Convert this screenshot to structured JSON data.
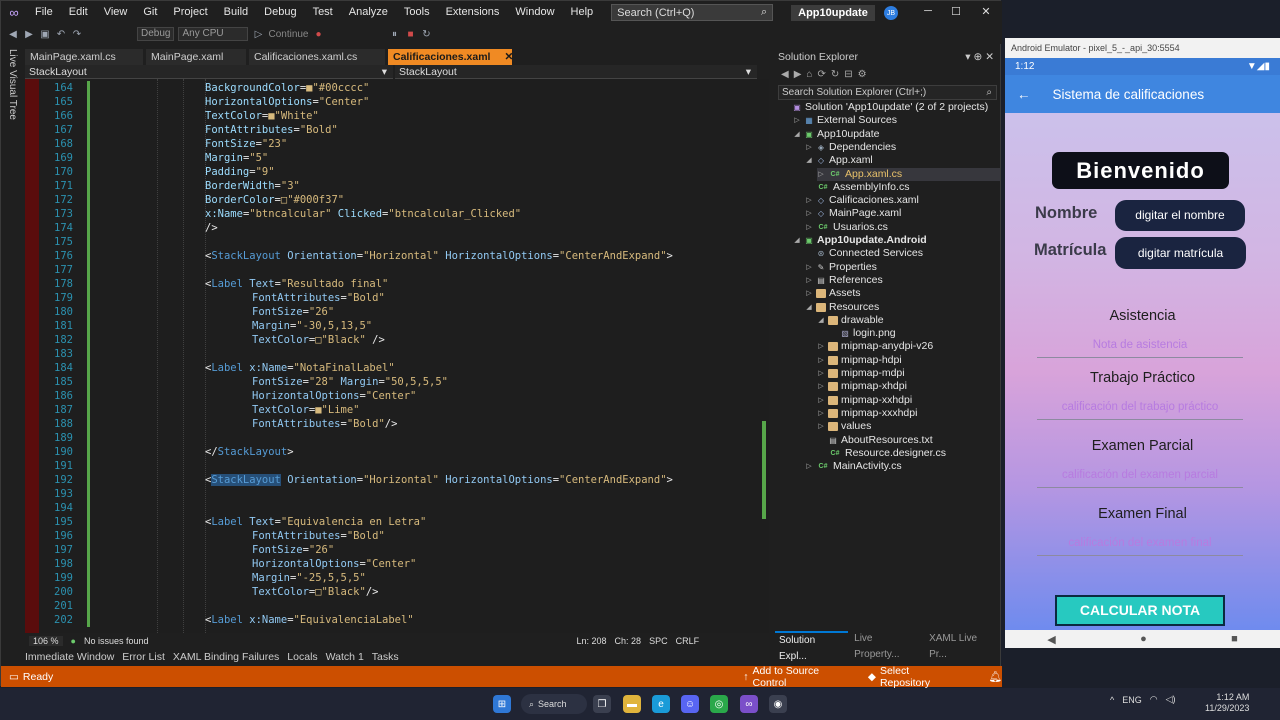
{
  "menubar": {
    "items": [
      "File",
      "Edit",
      "View",
      "Git",
      "Project",
      "Build",
      "Debug",
      "Test",
      "Analyze",
      "Tools",
      "Extensions",
      "Window",
      "Help"
    ],
    "search": "Search (Ctrl+Q)",
    "project": "App10update",
    "avatar": "JB"
  },
  "toolbar": {
    "config": "Debug",
    "platform": "Any CPU",
    "continue": "Continue"
  },
  "live_visual_tree": "Live Visual Tree",
  "tabs": [
    {
      "label": "MainPage.xaml.cs"
    },
    {
      "label": "MainPage.xaml"
    },
    {
      "label": "Calificaciones.xaml.cs"
    },
    {
      "label": "Calificaciones.xaml",
      "active": true
    }
  ],
  "nav": {
    "left": "StackLayout",
    "right": "StackLayout"
  },
  "code_lines": [
    {
      "n": "164",
      "parts": [
        [
          "attr",
          "BackgroundColor"
        ],
        [
          "eq",
          "="
        ],
        [
          "val",
          "■\"#00cccc\""
        ]
      ],
      "indent": 3
    },
    {
      "n": "165",
      "parts": [
        [
          "attr",
          "HorizontalOptions"
        ],
        [
          "eq",
          "="
        ],
        [
          "val",
          "\"Center\""
        ]
      ],
      "indent": 3
    },
    {
      "n": "166",
      "parts": [
        [
          "attr",
          "TextColor"
        ],
        [
          "eq",
          "="
        ],
        [
          "val",
          "■\"White\""
        ]
      ],
      "indent": 3
    },
    {
      "n": "167",
      "parts": [
        [
          "attr",
          "FontAttributes"
        ],
        [
          "eq",
          "="
        ],
        [
          "val",
          "\"Bold\""
        ]
      ],
      "indent": 3
    },
    {
      "n": "168",
      "parts": [
        [
          "attr",
          "FontSize"
        ],
        [
          "eq",
          "="
        ],
        [
          "val",
          "\"23\""
        ]
      ],
      "indent": 3
    },
    {
      "n": "169",
      "parts": [
        [
          "attr",
          "Margin"
        ],
        [
          "eq",
          "="
        ],
        [
          "val",
          "\"5\""
        ]
      ],
      "indent": 3
    },
    {
      "n": "170",
      "parts": [
        [
          "attr",
          "Padding"
        ],
        [
          "eq",
          "="
        ],
        [
          "val",
          "\"9\""
        ]
      ],
      "indent": 3
    },
    {
      "n": "171",
      "parts": [
        [
          "attr",
          "BorderWidth"
        ],
        [
          "eq",
          "="
        ],
        [
          "val",
          "\"3\""
        ]
      ],
      "indent": 3
    },
    {
      "n": "172",
      "parts": [
        [
          "attr",
          "BorderColor"
        ],
        [
          "eq",
          "="
        ],
        [
          "val",
          "□\"#000f37\""
        ]
      ],
      "indent": 3
    },
    {
      "n": "173",
      "parts": [
        [
          "attr",
          "x:Name"
        ],
        [
          "eq",
          "="
        ],
        [
          "val",
          "\"btncalcular\" "
        ],
        [
          "attr",
          "Clicked"
        ],
        [
          "eq",
          "="
        ],
        [
          "val",
          "\"btncalcular_Clicked\""
        ]
      ],
      "indent": 3
    },
    {
      "n": "174",
      "parts": [
        [
          "eq",
          "/>"
        ]
      ],
      "indent": 3
    },
    {
      "n": "175",
      "parts": [],
      "indent": 0
    },
    {
      "n": "176",
      "parts": [
        [
          "eq",
          "<"
        ],
        [
          "tag",
          "StackLayout "
        ],
        [
          "attrg",
          "Orientation"
        ],
        [
          "eq",
          "="
        ],
        [
          "val",
          "\"Horizontal\" "
        ],
        [
          "attrg",
          "HorizontalOptions"
        ],
        [
          "eq",
          "="
        ],
        [
          "val",
          "\"CenterAndExpand\""
        ],
        [
          "eq",
          ">"
        ]
      ],
      "indent": 2
    },
    {
      "n": "177",
      "parts": [],
      "indent": 0
    },
    {
      "n": "178",
      "parts": [
        [
          "eq",
          "<"
        ],
        [
          "tag",
          "Label "
        ],
        [
          "attrg",
          "Text"
        ],
        [
          "eq",
          "="
        ],
        [
          "val",
          "\"Resultado final\""
        ]
      ],
      "indent": 2
    },
    {
      "n": "179",
      "parts": [
        [
          "attrg",
          "FontAttributes"
        ],
        [
          "eq",
          "="
        ],
        [
          "val",
          "\"Bold\""
        ]
      ],
      "indent": 4
    },
    {
      "n": "180",
      "parts": [
        [
          "attrg",
          "FontSize"
        ],
        [
          "eq",
          "="
        ],
        [
          "val",
          "\"26\""
        ]
      ],
      "indent": 4
    },
    {
      "n": "181",
      "parts": [
        [
          "attrg",
          "Margin"
        ],
        [
          "eq",
          "="
        ],
        [
          "val",
          "\"-30,5,13,5\""
        ]
      ],
      "indent": 4
    },
    {
      "n": "182",
      "parts": [
        [
          "attrg",
          "TextColor"
        ],
        [
          "eq",
          "="
        ],
        [
          "val",
          "□\"Black\" "
        ],
        [
          "eq",
          "/>"
        ]
      ],
      "indent": 4
    },
    {
      "n": "183",
      "parts": [],
      "indent": 0
    },
    {
      "n": "184",
      "parts": [
        [
          "eq",
          "<"
        ],
        [
          "tag",
          "Label "
        ],
        [
          "attrg",
          "x:Name"
        ],
        [
          "eq",
          "="
        ],
        [
          "val",
          "\"NotaFinalLabel\""
        ]
      ],
      "indent": 2
    },
    {
      "n": "185",
      "parts": [
        [
          "attrg",
          "FontSize"
        ],
        [
          "eq",
          "="
        ],
        [
          "val",
          "\"28\" "
        ],
        [
          "attrg",
          "Margin"
        ],
        [
          "eq",
          "="
        ],
        [
          "val",
          "\"50,5,5,5\""
        ]
      ],
      "indent": 4
    },
    {
      "n": "186",
      "parts": [
        [
          "attrg",
          "HorizontalOptions"
        ],
        [
          "eq",
          "="
        ],
        [
          "val",
          "\"Center\""
        ]
      ],
      "indent": 4
    },
    {
      "n": "187",
      "parts": [
        [
          "attrg",
          "TextColor"
        ],
        [
          "eq",
          "="
        ],
        [
          "val",
          "■\"Lime\""
        ]
      ],
      "indent": 4
    },
    {
      "n": "188",
      "parts": [
        [
          "attrg",
          "FontAttributes"
        ],
        [
          "eq",
          "="
        ],
        [
          "val",
          "\"Bold\""
        ],
        [
          "eq",
          "/>"
        ]
      ],
      "indent": 4
    },
    {
      "n": "189",
      "parts": [],
      "indent": 0
    },
    {
      "n": "190",
      "parts": [
        [
          "eq",
          "</"
        ],
        [
          "tag",
          "StackLayout"
        ],
        [
          "eq",
          ">"
        ]
      ],
      "indent": 2
    },
    {
      "n": "191",
      "parts": [],
      "indent": 0
    },
    {
      "n": "192",
      "parts": [
        [
          "eq",
          "<"
        ],
        [
          "taghl",
          "StackLayout"
        ],
        [
          "attrg",
          " Orientation"
        ],
        [
          "eq",
          "="
        ],
        [
          "val",
          "\"Horizontal\" "
        ],
        [
          "attrg",
          "HorizontalOptions"
        ],
        [
          "eq",
          "="
        ],
        [
          "val",
          "\"CenterAndExpand\""
        ],
        [
          "eq",
          ">"
        ]
      ],
      "indent": 2
    },
    {
      "n": "193",
      "parts": [],
      "indent": 0
    },
    {
      "n": "194",
      "parts": [],
      "indent": 0
    },
    {
      "n": "195",
      "parts": [
        [
          "eq",
          "<"
        ],
        [
          "tag",
          "Label "
        ],
        [
          "attrg",
          "Text"
        ],
        [
          "eq",
          "="
        ],
        [
          "val",
          "\"Equivalencia en Letra\""
        ]
      ],
      "indent": 2
    },
    {
      "n": "196",
      "parts": [
        [
          "attrg",
          "FontAttributes"
        ],
        [
          "eq",
          "="
        ],
        [
          "val",
          "\"Bold\""
        ]
      ],
      "indent": 4
    },
    {
      "n": "197",
      "parts": [
        [
          "attrg",
          "FontSize"
        ],
        [
          "eq",
          "="
        ],
        [
          "val",
          "\"26\""
        ]
      ],
      "indent": 4
    },
    {
      "n": "198",
      "parts": [
        [
          "attrg",
          "HorizontalOptions"
        ],
        [
          "eq",
          "="
        ],
        [
          "val",
          "\"Center\""
        ]
      ],
      "indent": 4
    },
    {
      "n": "199",
      "parts": [
        [
          "attrg",
          "Margin"
        ],
        [
          "eq",
          "="
        ],
        [
          "val",
          "\"-25,5,5,5\""
        ]
      ],
      "indent": 4
    },
    {
      "n": "200",
      "parts": [
        [
          "attrg",
          "TextColor"
        ],
        [
          "eq",
          "="
        ],
        [
          "val",
          "□\"Black\""
        ],
        [
          "eq",
          "/>"
        ]
      ],
      "indent": 4
    },
    {
      "n": "201",
      "parts": [],
      "indent": 0
    },
    {
      "n": "202",
      "parts": [
        [
          "eq",
          "<"
        ],
        [
          "tag",
          "Label "
        ],
        [
          "attrg",
          "x:Name"
        ],
        [
          "eq",
          "="
        ],
        [
          "val",
          "\"EquivalenciaLabel\""
        ]
      ],
      "indent": 2
    }
  ],
  "editor_status": {
    "zoom": "106 %",
    "issues": "No issues found",
    "ln": "Ln: 208",
    "ch": "Ch: 28",
    "spc": "SPC",
    "crlf": "CRLF"
  },
  "solution_explorer": {
    "title": "Solution Explorer",
    "search": "Search Solution Explorer (Ctrl+;)",
    "items": [
      {
        "label": "Solution 'App10update' (2 of 2 projects)",
        "depth": 0,
        "icon": "sln"
      },
      {
        "label": "External Sources",
        "depth": 1,
        "icon": "ext",
        "arrow": "▷"
      },
      {
        "label": "App10update",
        "depth": 1,
        "icon": "proj",
        "arrow": "◢"
      },
      {
        "label": "Dependencies",
        "depth": 2,
        "icon": "dep",
        "arrow": "▷"
      },
      {
        "label": "App.xaml",
        "depth": 2,
        "icon": "xaml",
        "arrow": "◢"
      },
      {
        "label": "App.xaml.cs",
        "depth": 3,
        "icon": "cs",
        "arrow": "▷",
        "selected": true
      },
      {
        "label": "AssemblyInfo.cs",
        "depth": 2,
        "icon": "cs"
      },
      {
        "label": "Calificaciones.xaml",
        "depth": 2,
        "icon": "xaml",
        "arrow": "▷"
      },
      {
        "label": "MainPage.xaml",
        "depth": 2,
        "icon": "xaml",
        "arrow": "▷"
      },
      {
        "label": "Usuarios.cs",
        "depth": 2,
        "icon": "cs",
        "arrow": "▷"
      },
      {
        "label": "App10update.Android",
        "depth": 1,
        "icon": "proj",
        "arrow": "◢",
        "bold": true
      },
      {
        "label": "Connected Services",
        "depth": 2,
        "icon": "svc"
      },
      {
        "label": "Properties",
        "depth": 2,
        "icon": "prop",
        "arrow": "▷"
      },
      {
        "label": "References",
        "depth": 2,
        "icon": "ref",
        "arrow": "▷"
      },
      {
        "label": "Assets",
        "depth": 2,
        "icon": "folder",
        "arrow": "▷"
      },
      {
        "label": "Resources",
        "depth": 2,
        "icon": "folder",
        "arrow": "◢"
      },
      {
        "label": "drawable",
        "depth": 3,
        "icon": "folder",
        "arrow": "◢"
      },
      {
        "label": "login.png",
        "depth": 4,
        "icon": "png"
      },
      {
        "label": "mipmap-anydpi-v26",
        "depth": 3,
        "icon": "folder",
        "arrow": "▷"
      },
      {
        "label": "mipmap-hdpi",
        "depth": 3,
        "icon": "folder",
        "arrow": "▷"
      },
      {
        "label": "mipmap-mdpi",
        "depth": 3,
        "icon": "folder",
        "arrow": "▷"
      },
      {
        "label": "mipmap-xhdpi",
        "depth": 3,
        "icon": "folder",
        "arrow": "▷"
      },
      {
        "label": "mipmap-xxhdpi",
        "depth": 3,
        "icon": "folder",
        "arrow": "▷"
      },
      {
        "label": "mipmap-xxxhdpi",
        "depth": 3,
        "icon": "folder",
        "arrow": "▷"
      },
      {
        "label": "values",
        "depth": 3,
        "icon": "folder",
        "arrow": "▷"
      },
      {
        "label": "AboutResources.txt",
        "depth": 3,
        "icon": "txt"
      },
      {
        "label": "Resource.designer.cs",
        "depth": 3,
        "icon": "cs"
      },
      {
        "label": "MainActivity.cs",
        "depth": 2,
        "icon": "cs",
        "arrow": "▷"
      }
    ],
    "tabs": [
      "Solution Expl...",
      "Live Property...",
      "XAML Live Pr..."
    ]
  },
  "bottom_tabs": [
    "Immediate Window",
    "Error List",
    "XAML Binding Failures",
    "Locals",
    "Watch 1",
    "Tasks"
  ],
  "status": {
    "ready": "Ready",
    "source_control": "Add to Source Control",
    "repo": "Select Repository"
  },
  "emulator": {
    "title": "Android Emulator - pixel_5_-_api_30:5554",
    "time": "1:12",
    "app_title": "Sistema de calificaciones",
    "welcome": "Bienvenido",
    "nombre_label": "Nombre",
    "nombre_btn": "digitar el nombre",
    "matricula_label": "Matrícula",
    "matricula_btn": "digitar matrícula",
    "sections": [
      {
        "label": "Asistencia",
        "placeholder": "Nota de asistencia"
      },
      {
        "label": "Trabajo Práctico",
        "placeholder": "calificación del trabajo práctico"
      },
      {
        "label": "Examen Parcial",
        "placeholder": "calificación del examen parcial"
      },
      {
        "label": "Examen Final",
        "placeholder": "calificación del examen final"
      }
    ],
    "calc_btn": "CALCULAR NOTA"
  },
  "taskbar": {
    "search": "Search",
    "lang": "ENG",
    "time": "1:12 AM",
    "date": "11/29/2023"
  }
}
